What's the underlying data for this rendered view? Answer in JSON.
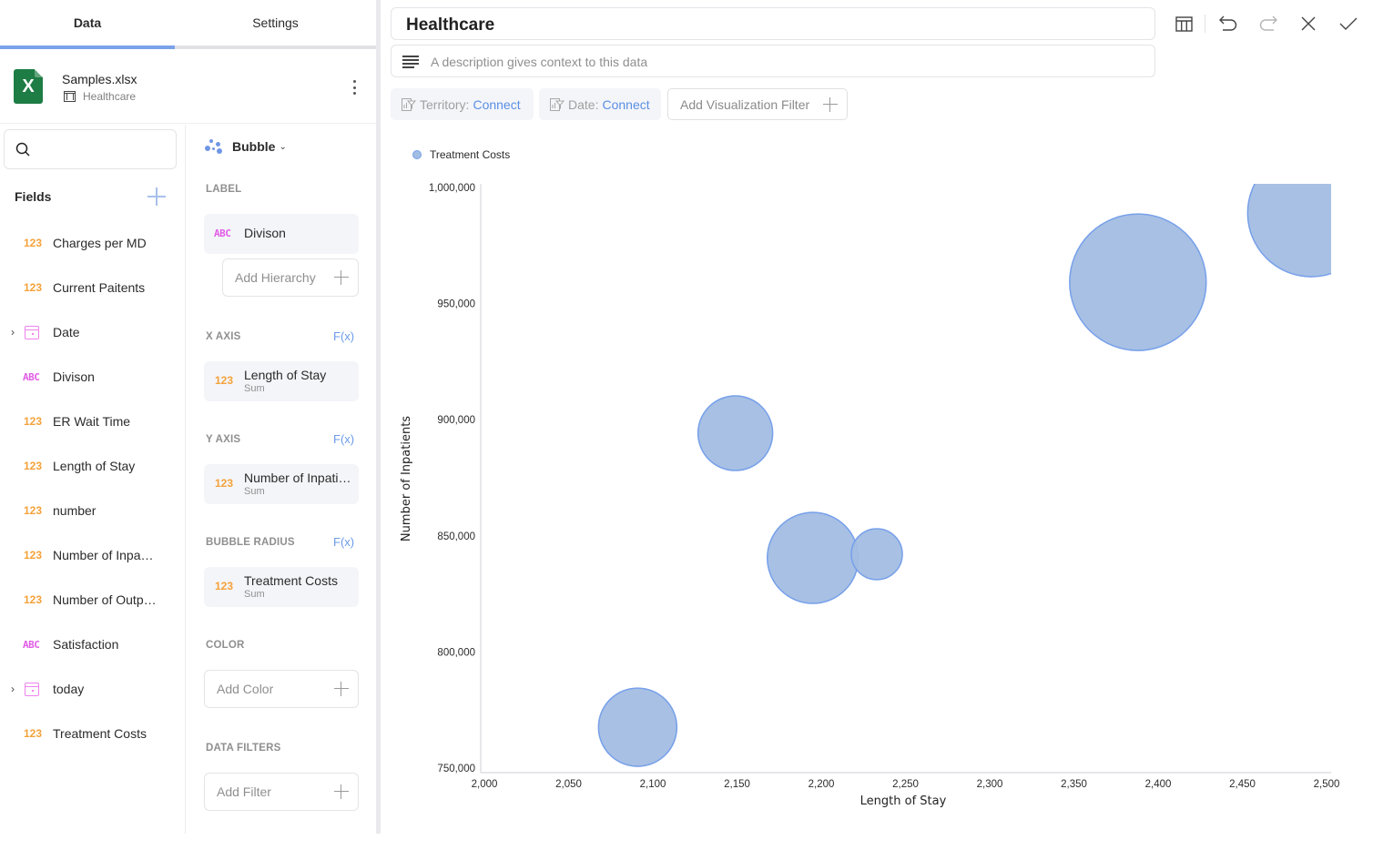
{
  "left_panel": {
    "tabs": [
      {
        "label": "Data",
        "active": true
      },
      {
        "label": "Settings",
        "active": false
      }
    ],
    "source": {
      "file_name": "Samples.xlsx",
      "sheet_name": "Healthcare",
      "icon": "excel-icon"
    },
    "search": {
      "placeholder": "",
      "value": ""
    },
    "fields_header": "Fields",
    "fields": [
      {
        "label": "Charges per MD",
        "type": "number",
        "type_glyph": "123"
      },
      {
        "label": "Current Paitents",
        "type": "number",
        "type_glyph": "123"
      },
      {
        "label": "Date",
        "type": "date",
        "expandable": true
      },
      {
        "label": "Divison",
        "type": "text",
        "type_glyph": "ABC"
      },
      {
        "label": "ER Wait Time",
        "type": "number",
        "type_glyph": "123"
      },
      {
        "label": "Length of Stay",
        "type": "number",
        "type_glyph": "123"
      },
      {
        "label": "number",
        "type": "number",
        "type_glyph": "123"
      },
      {
        "label": "Number of Inpa…",
        "type": "number",
        "type_glyph": "123"
      },
      {
        "label": "Number of Outp…",
        "type": "number",
        "type_glyph": "123"
      },
      {
        "label": "Satisfaction",
        "type": "text",
        "type_glyph": "ABC"
      },
      {
        "label": "today",
        "type": "date",
        "expandable": true
      },
      {
        "label": "Treatment Costs",
        "type": "number",
        "type_glyph": "123"
      }
    ]
  },
  "config": {
    "visualization": "Bubble",
    "fx_label": "F(x)",
    "sections": {
      "label": {
        "title": "LABEL",
        "field": {
          "name": "Divison",
          "type_glyph": "ABC"
        },
        "add_hierarchy": "Add Hierarchy"
      },
      "x_axis": {
        "title": "X AXIS",
        "field": {
          "name": "Length of Stay",
          "aggregation": "Sum",
          "type_glyph": "123"
        }
      },
      "y_axis": {
        "title": "Y AXIS",
        "field": {
          "name": "Number of Inpatie…",
          "aggregation": "Sum",
          "type_glyph": "123"
        }
      },
      "bubble_radius": {
        "title": "BUBBLE RADIUS",
        "field": {
          "name": "Treatment Costs",
          "aggregation": "Sum",
          "type_glyph": "123"
        }
      },
      "color": {
        "title": "COLOR",
        "add_label": "Add Color"
      },
      "data_filters": {
        "title": "DATA FILTERS",
        "add_label": "Add Filter"
      }
    }
  },
  "editor": {
    "title": "Healthcare",
    "description_placeholder": "A description gives context to this data",
    "toolbar": [
      "table-view-icon",
      "undo-icon",
      "redo-icon",
      "close-icon",
      "check-icon"
    ],
    "filters": [
      {
        "key": "Territory:",
        "value": "Connect"
      },
      {
        "key": "Date:",
        "value": "Connect"
      }
    ],
    "add_viz_filter": "Add Visualization Filter"
  },
  "colors": {
    "accent": "#7aa2e8",
    "bubble_fill": "#a2bde3",
    "bubble_stroke": "#77a0ea",
    "number_type": "#f4a23a",
    "text_type": "#e15ce6",
    "date_type": "#ef82ee",
    "link": "#5b8fe3"
  },
  "chart_data": {
    "type": "scatter",
    "subtype": "bubble",
    "title": "",
    "xlabel": "Length of Stay",
    "ylabel": "Number of Inpatients",
    "xlim": [
      2000,
      2500
    ],
    "ylim": [
      750000,
      1000000
    ],
    "x_ticks": [
      "2,000",
      "2,050",
      "2,100",
      "2,150",
      "2,200",
      "2,250",
      "2,300",
      "2,350",
      "2,400",
      "2,450",
      "2,500"
    ],
    "x_tick_values": [
      2000,
      2050,
      2100,
      2150,
      2200,
      2250,
      2300,
      2350,
      2400,
      2450,
      2500
    ],
    "y_ticks": [
      "750,000",
      "800,000",
      "850,000",
      "900,000",
      "950,000",
      "1,000,000"
    ],
    "y_tick_values": [
      750000,
      800000,
      850000,
      900000,
      950000,
      1000000
    ],
    "grid": false,
    "legend": {
      "position": "top-left",
      "entries": [
        "Treatment Costs"
      ]
    },
    "series": [
      {
        "name": "Treatment Costs",
        "points": [
          {
            "x": 2091,
            "y": 767600,
            "size": 43
          },
          {
            "x": 2149,
            "y": 894200,
            "size": 41
          },
          {
            "x": 2195,
            "y": 840500,
            "size": 50
          },
          {
            "x": 2233,
            "y": 842100,
            "size": 28
          },
          {
            "x": 2388,
            "y": 959200,
            "size": 75
          },
          {
            "x": 2491,
            "y": 989000,
            "size": 70
          }
        ]
      }
    ]
  }
}
